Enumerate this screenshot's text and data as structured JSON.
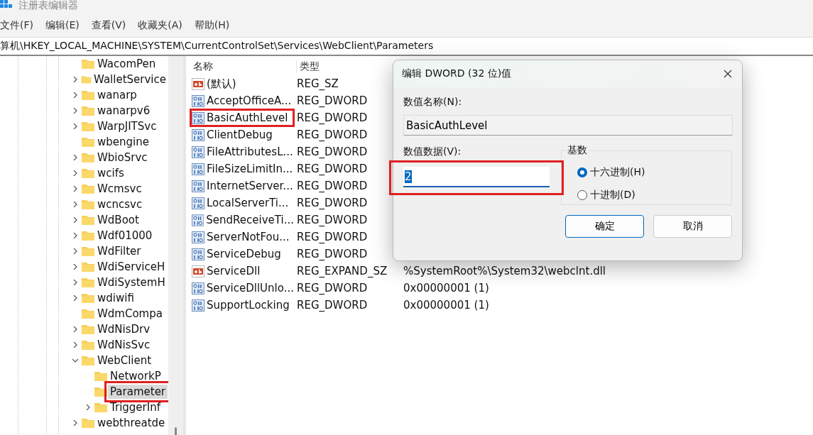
{
  "window": {
    "title": "注册表编辑器"
  },
  "menu": [
    "文件(F)",
    "编辑(E)",
    "查看(V)",
    "收藏夹(A)",
    "帮助(H)"
  ],
  "address": "算机\\HKEY_LOCAL_MACHINE\\SYSTEM\\CurrentControlSet\\Services\\WebClient\\Parameters",
  "tree": [
    {
      "label": "WacomPen",
      "expandable": false,
      "selected": false,
      "highlighted": false
    },
    {
      "label": "WalletService",
      "expandable": true,
      "selected": false,
      "highlighted": false
    },
    {
      "label": "wanarp",
      "expandable": true,
      "selected": false,
      "highlighted": false
    },
    {
      "label": "wanarpv6",
      "expandable": true,
      "selected": false,
      "highlighted": false
    },
    {
      "label": "WarpJITSvc",
      "expandable": true,
      "selected": false,
      "highlighted": false
    },
    {
      "label": "wbengine",
      "expandable": false,
      "selected": false,
      "highlighted": false
    },
    {
      "label": "WbioSrvc",
      "expandable": true,
      "selected": false,
      "highlighted": false
    },
    {
      "label": "wcifs",
      "expandable": true,
      "selected": false,
      "highlighted": false
    },
    {
      "label": "Wcmsvc",
      "expandable": true,
      "selected": false,
      "highlighted": false
    },
    {
      "label": "wcncsvc",
      "expandable": true,
      "selected": false,
      "highlighted": false
    },
    {
      "label": "WdBoot",
      "expandable": true,
      "selected": false,
      "highlighted": false
    },
    {
      "label": "Wdf01000",
      "expandable": true,
      "selected": false,
      "highlighted": false
    },
    {
      "label": "WdFilter",
      "expandable": true,
      "selected": false,
      "highlighted": false
    },
    {
      "label": "WdiServiceH",
      "expandable": true,
      "selected": false,
      "highlighted": false
    },
    {
      "label": "WdiSystemH",
      "expandable": true,
      "selected": false,
      "highlighted": false
    },
    {
      "label": "wdiwifi",
      "expandable": true,
      "selected": false,
      "highlighted": false
    },
    {
      "label": "WdmCompa",
      "expandable": false,
      "selected": false,
      "highlighted": false
    },
    {
      "label": "WdNisDrv",
      "expandable": true,
      "selected": false,
      "highlighted": false
    },
    {
      "label": "WdNisSvc",
      "expandable": true,
      "selected": false,
      "highlighted": false
    },
    {
      "label": "WebClient",
      "expandable": true,
      "expanded": true,
      "selected": false,
      "highlighted": false,
      "children": [
        {
          "label": "NetworkP",
          "expandable": false,
          "selected": false,
          "highlighted": false
        },
        {
          "label": "Parameter",
          "expandable": false,
          "selected": true,
          "highlighted": true
        },
        {
          "label": "TriggerInf",
          "expandable": true,
          "selected": false,
          "highlighted": false
        }
      ]
    },
    {
      "label": "webthreatde",
      "expandable": true,
      "selected": false,
      "highlighted": false
    }
  ],
  "list": {
    "columns": [
      "名称",
      "类型"
    ],
    "rows": [
      {
        "kind": "string",
        "name": "(默认)",
        "type": "REG_SZ",
        "highlighted": false
      },
      {
        "kind": "binary",
        "name": "AcceptOfficeA...",
        "type": "REG_DWORD",
        "highlighted": false
      },
      {
        "kind": "binary",
        "name": "BasicAuthLevel",
        "type": "REG_DWORD",
        "highlighted": true
      },
      {
        "kind": "binary",
        "name": "ClientDebug",
        "type": "REG_DWORD",
        "highlighted": false
      },
      {
        "kind": "binary",
        "name": "FileAttributesL...",
        "type": "REG_DWORD",
        "highlighted": false
      },
      {
        "kind": "binary",
        "name": "FileSizeLimitIn...",
        "type": "REG_DWORD",
        "highlighted": false
      },
      {
        "kind": "binary",
        "name": "InternetServer...",
        "type": "REG_DWORD",
        "highlighted": false
      },
      {
        "kind": "binary",
        "name": "LocalServerTi...",
        "type": "REG_DWORD",
        "highlighted": false
      },
      {
        "kind": "binary",
        "name": "SendReceiveTi...",
        "type": "REG_DWORD",
        "highlighted": false
      },
      {
        "kind": "binary",
        "name": "ServerNotFou...",
        "type": "REG_DWORD",
        "highlighted": false
      },
      {
        "kind": "binary",
        "name": "ServiceDebug",
        "type": "REG_DWORD",
        "highlighted": false
      },
      {
        "kind": "string",
        "name": "ServiceDll",
        "type": "REG_EXPAND_SZ",
        "data": "%SystemRoot%\\System32\\webclnt.dll",
        "highlighted": false
      },
      {
        "kind": "binary",
        "name": "ServiceDllUnlo...",
        "type": "REG_DWORD",
        "data": "0x00000001 (1)",
        "highlighted": false
      },
      {
        "kind": "binary",
        "name": "SupportLocking",
        "type": "REG_DWORD",
        "data": "0x00000001 (1)",
        "highlighted": false
      }
    ]
  },
  "dialog": {
    "title": "编辑 DWORD (32 位)值",
    "name_label": "数值名称(N):",
    "name_value": "BasicAuthLevel",
    "data_label": "数值数据(V):",
    "data_value": "2",
    "data_highlighted": true,
    "base_label": "基数",
    "radios": [
      {
        "label": "十六进制(H)",
        "selected": true
      },
      {
        "label": "十进制(D)",
        "selected": false
      }
    ],
    "buttons": [
      "确定",
      "取消"
    ]
  }
}
